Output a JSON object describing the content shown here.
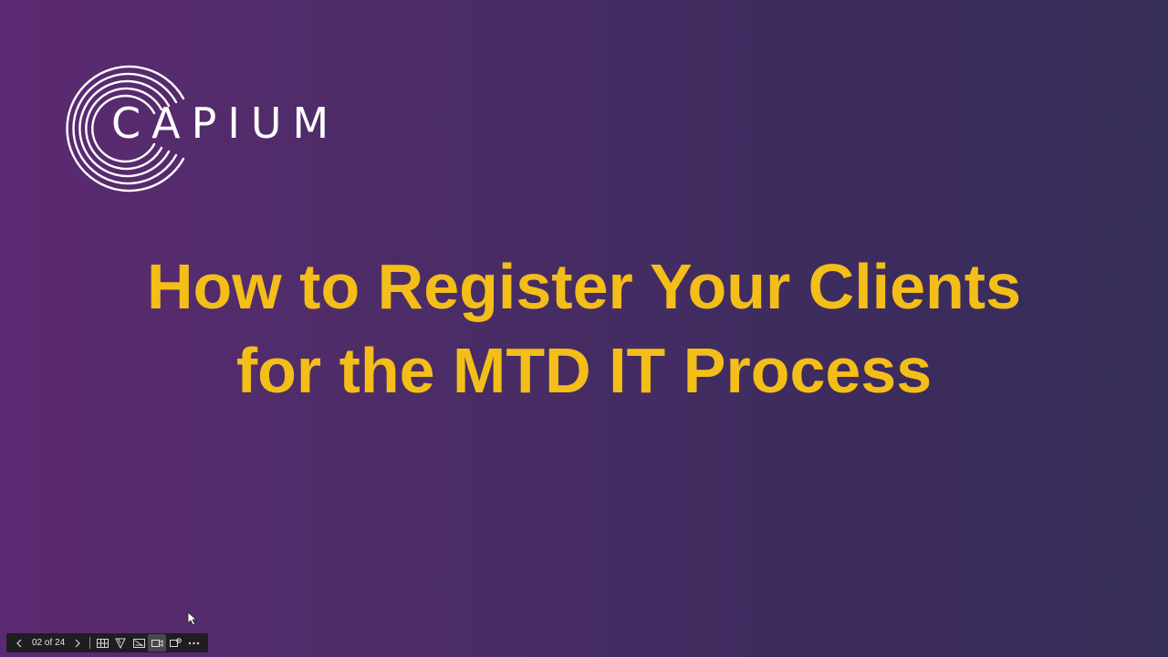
{
  "slide": {
    "brand": "CAPIUM",
    "title_lines": [
      "How to Register Your Clients",
      "for the MTD IT Process"
    ]
  },
  "toolbar": {
    "counter": "02 of 24",
    "icons": [
      "chevron-left-icon",
      "chevron-right-icon",
      "grid-icon",
      "pen-icon",
      "subtitles-icon",
      "camera-icon",
      "live-icon",
      "more-icon"
    ]
  },
  "colors": {
    "background_left": "#5c2a72",
    "background_right": "#362d58",
    "title": "#f4be19",
    "brand_text": "#ffffff",
    "toolbar_bg": "#1f1d22"
  }
}
